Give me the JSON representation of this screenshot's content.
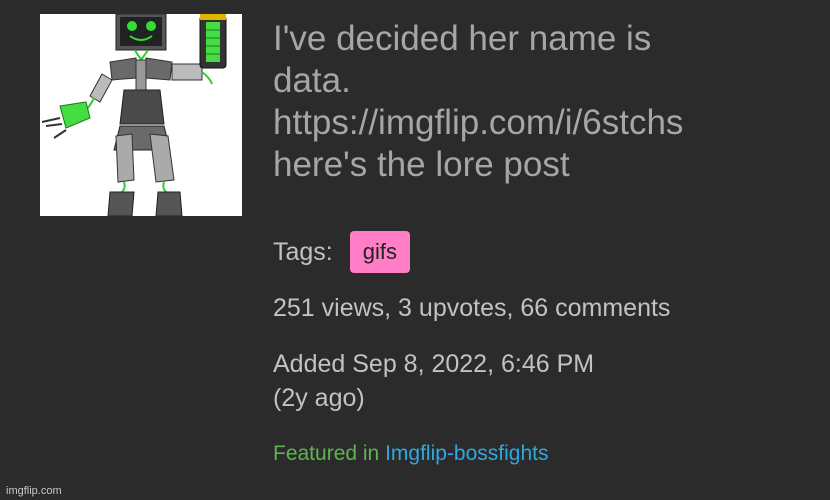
{
  "post": {
    "title_lines": [
      "I've decided her name is",
      "data.",
      "https://imgflip.com/i/6stchs",
      "here's the lore post"
    ],
    "tags_label": "Tags:",
    "tags": [
      "gifs"
    ],
    "stats": "251 views, 3 upvotes, 66 comments",
    "added_lines": [
      "Added Sep 8, 2022, 6:46 PM",
      "(2y ago)"
    ],
    "featured_label": "Featured in",
    "featured_stream": "Imgflip-bossfights"
  },
  "thumbnail": {
    "icon": "robot-drawing-icon"
  },
  "watermark": "imgflip.com",
  "colors": {
    "background": "#2b2b2b",
    "tag_bg": "#ff7ec5",
    "featured_label": "#5eb54f",
    "featured_link": "#2fa8e0",
    "robot_eyes": "#33dd33"
  }
}
